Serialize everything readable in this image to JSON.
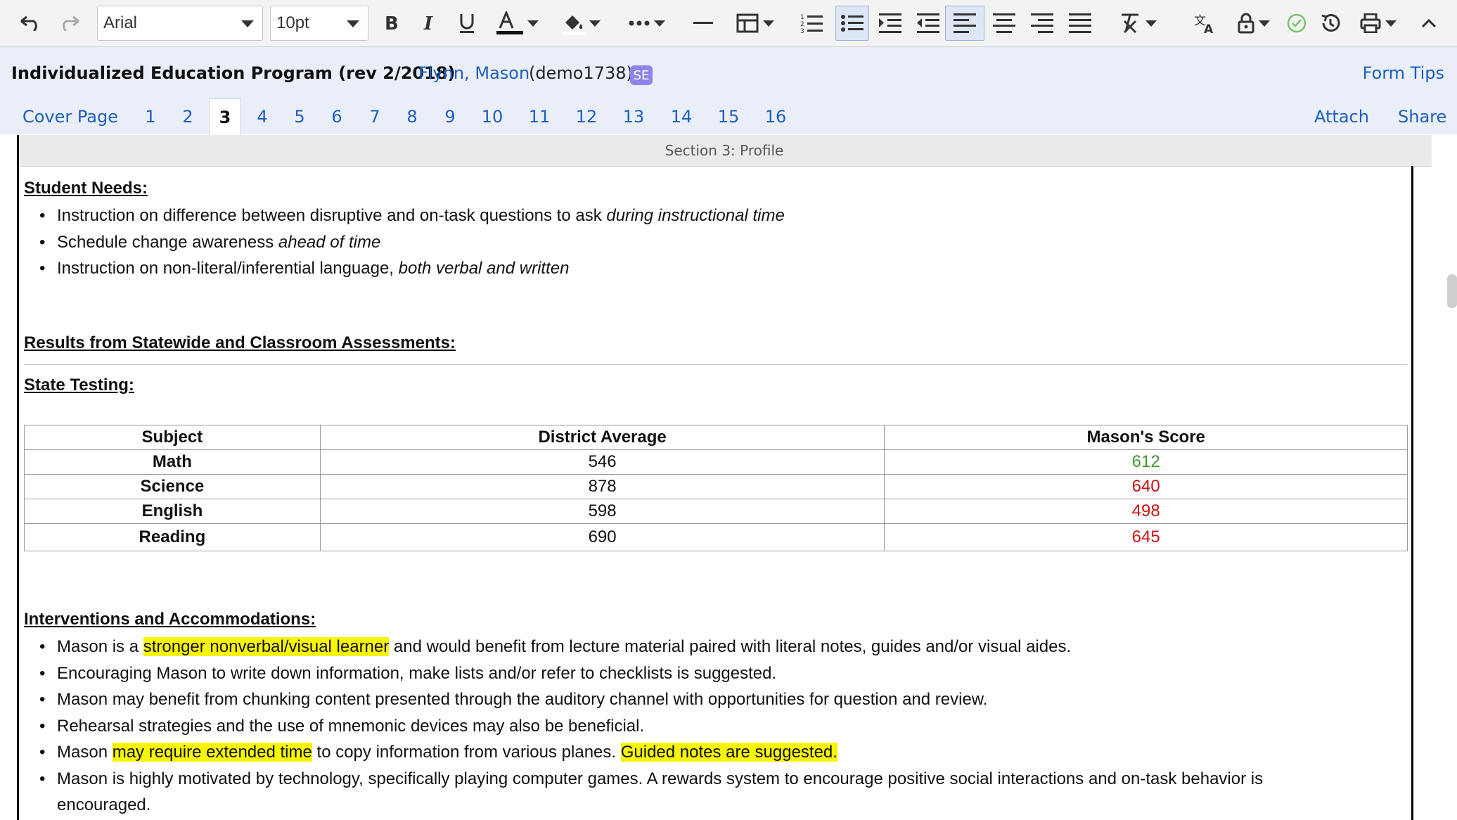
{
  "toolbar": {
    "font": "Arial",
    "size": "10pt"
  },
  "header": {
    "title": "Individualized Education Program (rev 2/2018)",
    "student_name": "Flynn, Mason",
    "student_id": "(demo1738)",
    "badge": "SE",
    "form_tips": "Form Tips"
  },
  "tabs": {
    "items": [
      "Cover Page",
      "1",
      "2",
      "3",
      "4",
      "5",
      "6",
      "7",
      "8",
      "9",
      "10",
      "11",
      "12",
      "13",
      "14",
      "15",
      "16"
    ],
    "current": "3",
    "attach": "Attach",
    "share": "Share"
  },
  "section": {
    "title": "Section 3: Profile"
  },
  "needs": {
    "heading": "Student Needs:",
    "items": [
      {
        "text": "Instruction on difference between disruptive and on-task questions to ask ",
        "em": "during instructional time"
      },
      {
        "text": "Schedule change awareness ",
        "em": "ahead of time"
      },
      {
        "text": "Instruction on non-literal/inferential language, ",
        "em": "both verbal and written"
      }
    ]
  },
  "assessments": {
    "heading": "Results from Statewide and Classroom Assessments:",
    "state_heading": "State Testing:",
    "columns": [
      "Subject",
      "District Average",
      "Mason's Score"
    ],
    "rows": [
      {
        "subject": "Math",
        "district": "546",
        "score": "612",
        "score_color": "#3c9a2c"
      },
      {
        "subject": "Science",
        "district": "878",
        "score": "640",
        "score_color": "#cc1111"
      },
      {
        "subject": "English",
        "district": "598",
        "score": "498",
        "score_color": "#cc1111"
      },
      {
        "subject": "Reading",
        "district": "690",
        "score": "645",
        "score_color": "#cc1111"
      }
    ]
  },
  "interventions": {
    "heading": "Interventions and Accommodations:",
    "item1": {
      "a": "Mason is a ",
      "hl": "stronger nonverbal/visual learner",
      "b": " and would benefit from lecture material paired with literal notes, guides and/or visual aides."
    },
    "item2": "Encouraging Mason to write down information, make lists and/or refer to checklists is suggested.",
    "item3": "Mason may benefit from chunking content presented through the auditory channel with opportunities for question and review.",
    "item4": "Rehearsal strategies and the use of mnemonic devices may also be beneficial.",
    "item5": {
      "a": "Mason ",
      "hl1": "may require extended time",
      "b": " to copy information from various planes. ",
      "hl2": "Guided notes are suggested. "
    },
    "item6_line1": "Mason is highly motivated by technology, specifically playing computer games.  A rewards system to encourage positive social interactions and on-task behavior is",
    "item6_line2": "encouraged."
  }
}
